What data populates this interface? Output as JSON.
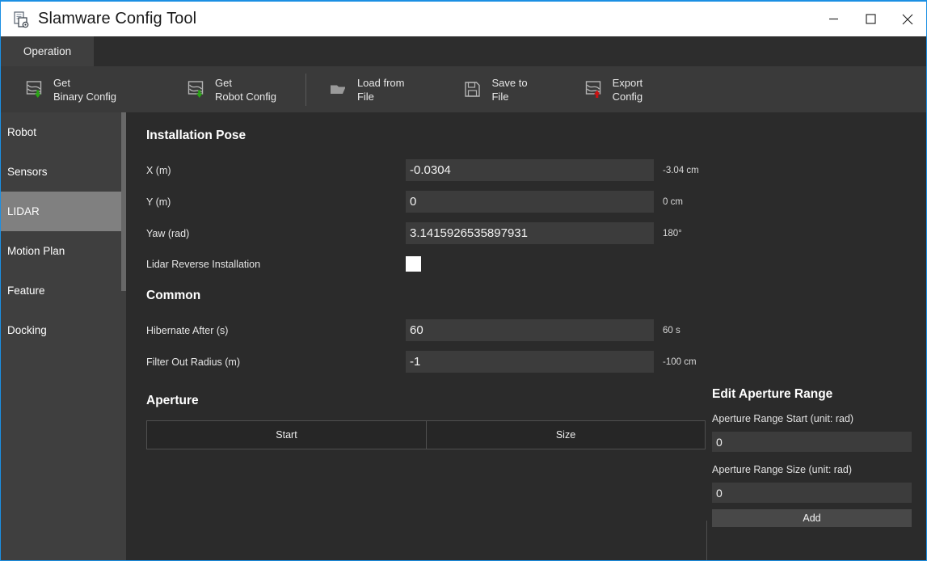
{
  "window": {
    "title": "Slamware Config Tool",
    "app_icon": "config-document-icon",
    "controls": {
      "minimize": "minimize-icon",
      "maximize": "maximize-icon",
      "close": "close-icon"
    },
    "accent_border": "#1b8fe3"
  },
  "tabs": [
    {
      "label": "Operation",
      "active": true
    }
  ],
  "toolbar": {
    "items": [
      {
        "label": "Get\nBinary Config",
        "icon": "import-config-icon"
      },
      {
        "label": "Get\nRobot Config",
        "icon": "import-config-icon"
      },
      {
        "label": "Load from\nFile",
        "icon": "folder-open-icon"
      },
      {
        "label": "Save to\nFile",
        "icon": "floppy-save-icon"
      },
      {
        "label": "Export\nConfig",
        "icon": "export-config-icon"
      }
    ]
  },
  "sidebar": {
    "items": [
      {
        "label": "Robot",
        "active": false
      },
      {
        "label": "Sensors",
        "active": false
      },
      {
        "label": "LIDAR",
        "active": true
      },
      {
        "label": "Motion Plan",
        "active": false
      },
      {
        "label": "Feature",
        "active": false
      },
      {
        "label": "Docking",
        "active": false
      }
    ]
  },
  "main": {
    "installation_pose": {
      "title": "Installation Pose",
      "fields": [
        {
          "label": "X (m)",
          "value": "-0.0304",
          "hint": "-3.04 cm",
          "type": "text"
        },
        {
          "label": "Y (m)",
          "value": "0",
          "hint": "0 cm",
          "type": "text"
        },
        {
          "label": "Yaw (rad)",
          "value": "3.1415926535897931",
          "hint": "180°",
          "type": "text"
        },
        {
          "label": "Lidar Reverse Installation",
          "value": "",
          "hint": "",
          "type": "checkbox",
          "checked": false
        }
      ]
    },
    "common": {
      "title": "Common",
      "fields": [
        {
          "label": "Hibernate After (s)",
          "value": "60",
          "hint": "60 s",
          "type": "text"
        },
        {
          "label": "Filter Out Radius (m)",
          "value": "-1",
          "hint": "-100 cm",
          "type": "text"
        }
      ]
    },
    "aperture": {
      "title": "Aperture",
      "columns": [
        "Start",
        "Size"
      ],
      "rows": []
    }
  },
  "edit_aperture_range": {
    "title": "Edit Aperture Range",
    "start_label": "Aperture Range Start (unit: rad)",
    "start_value": "0",
    "size_label": "Aperture Range Size (unit: rad)",
    "size_value": "0",
    "add_label": "Add"
  }
}
